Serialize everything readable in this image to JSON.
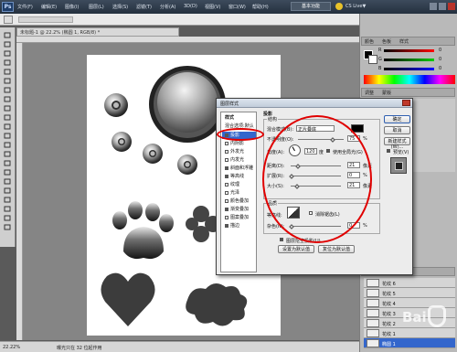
{
  "app": {
    "logo": "Ps",
    "workspace": "基本功能",
    "cslive": "CS Live▼"
  },
  "menu": [
    "文件(F)",
    "编辑(E)",
    "图像(I)",
    "图层(L)",
    "选择(S)",
    "滤镜(T)",
    "分析(A)",
    "3D(D)",
    "视图(V)",
    "窗口(W)",
    "帮助(H)"
  ],
  "menubar_extra": {
    "zoom": "22.2",
    "workspace_icons": "▾"
  },
  "document": {
    "tab_title": "未标题-1 @ 22.2% (椭圆 1, RGB/8) *"
  },
  "status": {
    "zoom": "22.22%",
    "info": "曝光只在 32 位起作用"
  },
  "right_panel": {
    "tabs": [
      "颜色",
      "色板",
      "样式"
    ],
    "adjust_tabs": [
      "调整",
      "蒙版"
    ],
    "layers_tabs": [
      "图层",
      "通道",
      "路径"
    ],
    "sliders": [
      {
        "label": "R",
        "value": "0"
      },
      {
        "label": "G",
        "value": "0"
      },
      {
        "label": "B",
        "value": "0"
      }
    ],
    "layers": [
      "花纹 6",
      "花纹 5",
      "花纹 4",
      "花纹 3",
      "花纹 2",
      "花纹 1",
      "椭圆 1"
    ]
  },
  "dialog": {
    "title": "图层样式",
    "style_list": {
      "header": "样式",
      "blend": "混合选项:默认",
      "items": [
        {
          "label": "投影",
          "checked": true,
          "selected": true
        },
        {
          "label": "内阴影",
          "checked": false
        },
        {
          "label": "外发光",
          "checked": false
        },
        {
          "label": "内发光",
          "checked": false
        },
        {
          "label": "斜面和浮雕",
          "checked": true
        },
        {
          "label": "等高线",
          "checked": true
        },
        {
          "label": "纹理",
          "checked": false
        },
        {
          "label": "光泽",
          "checked": false
        },
        {
          "label": "颜色叠加",
          "checked": false
        },
        {
          "label": "渐变叠加",
          "checked": true
        },
        {
          "label": "图案叠加",
          "checked": false
        },
        {
          "label": "描边",
          "checked": true
        }
      ]
    },
    "section_title": "投影",
    "structure": {
      "title": "结构",
      "blend_mode_label": "混合模式(B):",
      "blend_mode_value": "正片叠底",
      "opacity_label": "不透明度(O):",
      "opacity_value": "75",
      "angle_label": "角度(A):",
      "angle_value": "120",
      "angle_unit": "度",
      "global_light": "使用全局光(G)",
      "distance_label": "距离(D):",
      "distance_value": "21",
      "spread_label": "扩展(R):",
      "spread_value": "0",
      "size_label": "大小(S):",
      "size_value": "21",
      "px": "像素",
      "pct": "%"
    },
    "quality": {
      "title": "品质",
      "contour_label": "等高线:",
      "antialias": "消除锯齿(L)",
      "noise_label": "杂色(N):",
      "noise_value": "0"
    },
    "knockout": "图层挖空投影(U)",
    "set_default": "设置为默认值",
    "reset_default": "复位为默认值",
    "buttons": {
      "ok": "确定",
      "cancel": "取消",
      "new_style": "新建样式(W)...",
      "preview": "预览(V)"
    },
    "shadow_color": "#000000"
  },
  "watermark": "Bai",
  "colors": {
    "accent": "#3366cc",
    "highlight": "#e00000"
  }
}
